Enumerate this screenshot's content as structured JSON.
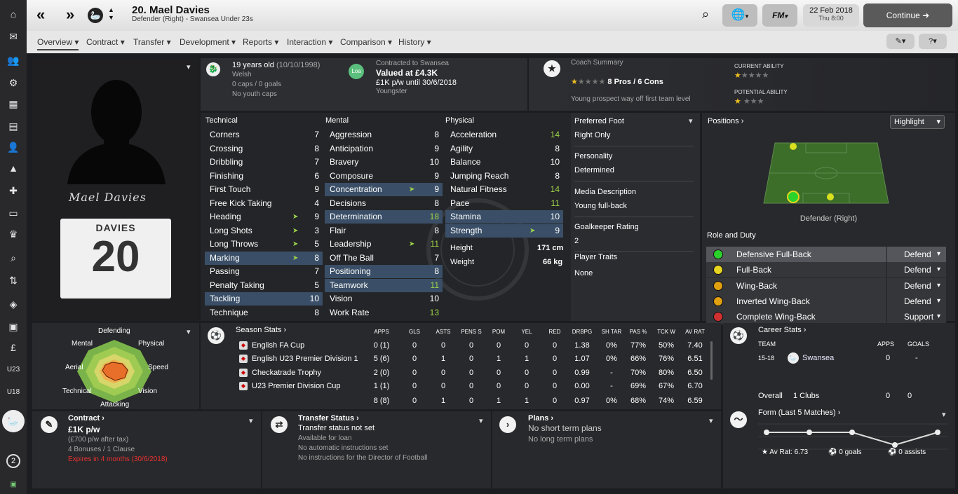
{
  "header": {
    "title": "20. Mael Davies",
    "subtitle": "Defender (Right) - Swansea Under 23s",
    "date": "22 Feb 2018",
    "day_time": "Thu 8:00",
    "continue_label": "Continue",
    "fm_label": "FM"
  },
  "nav": [
    "Overview",
    "Contract",
    "Transfer",
    "Development",
    "Reports",
    "Interaction",
    "Comparison",
    "History"
  ],
  "sidebar": {
    "badge_count": "2"
  },
  "profile": {
    "age": "19 years old",
    "dob": "(10/10/1998)",
    "nationality": "Welsh",
    "caps": "0 caps / 0 goals",
    "youth_caps": "No youth caps",
    "signature": "Mael Davies",
    "shirt_name": "DAVIES",
    "shirt_number": "20"
  },
  "contract_top": {
    "loan_badge": "Loa",
    "contracted": "Contracted to Swansea",
    "value": "Valued at £4.3K",
    "wage": "£1K p/w until 30/6/2018",
    "status": "Youngster"
  },
  "coach": {
    "title": "Coach Summary",
    "pros": "8 Pros / 6 Cons",
    "note": "Young prospect way off first team level",
    "ca_label": "CURRENT ABILITY",
    "pa_label": "POTENTIAL ABILITY",
    "ca_stars": 1,
    "pa_stars": 1
  },
  "technical": {
    "title": "Technical",
    "items": [
      {
        "name": "Corners",
        "value": "7",
        "hl": false,
        "arrow": false
      },
      {
        "name": "Crossing",
        "value": "8",
        "hl": false,
        "arrow": false
      },
      {
        "name": "Dribbling",
        "value": "7",
        "hl": false,
        "arrow": false
      },
      {
        "name": "Finishing",
        "value": "6",
        "hl": false,
        "arrow": false
      },
      {
        "name": "First Touch",
        "value": "9",
        "hl": false,
        "arrow": false
      },
      {
        "name": "Free Kick Taking",
        "value": "4",
        "hl": false,
        "arrow": false
      },
      {
        "name": "Heading",
        "value": "9",
        "hl": false,
        "arrow": true
      },
      {
        "name": "Long Shots",
        "value": "3",
        "hl": false,
        "arrow": true
      },
      {
        "name": "Long Throws",
        "value": "5",
        "hl": false,
        "arrow": true
      },
      {
        "name": "Marking",
        "value": "8",
        "hl": true,
        "arrow": true
      },
      {
        "name": "Passing",
        "value": "7",
        "hl": false,
        "arrow": false
      },
      {
        "name": "Penalty Taking",
        "value": "5",
        "hl": false,
        "arrow": false
      },
      {
        "name": "Tackling",
        "value": "10",
        "hl": true,
        "arrow": false
      },
      {
        "name": "Technique",
        "value": "8",
        "hl": false,
        "arrow": false
      }
    ]
  },
  "mental": {
    "title": "Mental",
    "items": [
      {
        "name": "Aggression",
        "value": "8",
        "hl": false,
        "arrow": false,
        "green": false
      },
      {
        "name": "Anticipation",
        "value": "9",
        "hl": false,
        "arrow": false,
        "green": false
      },
      {
        "name": "Bravery",
        "value": "10",
        "hl": false,
        "arrow": false,
        "green": false
      },
      {
        "name": "Composure",
        "value": "9",
        "hl": false,
        "arrow": false,
        "green": false
      },
      {
        "name": "Concentration",
        "value": "9",
        "hl": true,
        "arrow": true,
        "green": false
      },
      {
        "name": "Decisions",
        "value": "8",
        "hl": false,
        "arrow": false,
        "green": false
      },
      {
        "name": "Determination",
        "value": "18",
        "hl": true,
        "arrow": false,
        "green": true
      },
      {
        "name": "Flair",
        "value": "8",
        "hl": false,
        "arrow": false,
        "green": false
      },
      {
        "name": "Leadership",
        "value": "11",
        "hl": false,
        "arrow": true,
        "green": true
      },
      {
        "name": "Off The Ball",
        "value": "7",
        "hl": false,
        "arrow": false,
        "green": false
      },
      {
        "name": "Positioning",
        "value": "8",
        "hl": true,
        "arrow": false,
        "green": false
      },
      {
        "name": "Teamwork",
        "value": "11",
        "hl": true,
        "arrow": false,
        "green": true
      },
      {
        "name": "Vision",
        "value": "10",
        "hl": false,
        "arrow": false,
        "green": false
      },
      {
        "name": "Work Rate",
        "value": "13",
        "hl": false,
        "arrow": false,
        "green": true
      }
    ]
  },
  "physical": {
    "title": "Physical",
    "items": [
      {
        "name": "Acceleration",
        "value": "14",
        "hl": false,
        "arrow": false,
        "green": true
      },
      {
        "name": "Agility",
        "value": "8",
        "hl": false,
        "arrow": false,
        "green": false
      },
      {
        "name": "Balance",
        "value": "10",
        "hl": false,
        "arrow": false,
        "green": false
      },
      {
        "name": "Jumping Reach",
        "value": "8",
        "hl": false,
        "arrow": false,
        "green": false
      },
      {
        "name": "Natural Fitness",
        "value": "14",
        "hl": false,
        "arrow": false,
        "green": true
      },
      {
        "name": "Pace",
        "value": "11",
        "hl": false,
        "arrow": false,
        "green": true
      },
      {
        "name": "Stamina",
        "value": "10",
        "hl": true,
        "arrow": false,
        "green": false
      },
      {
        "name": "Strength",
        "value": "9",
        "hl": true,
        "arrow": true,
        "green": false
      }
    ],
    "height_label": "Height",
    "height": "171 cm",
    "weight_label": "Weight",
    "weight": "66 kg"
  },
  "info": {
    "foot_label": "Preferred Foot",
    "foot": "Right Only",
    "personality_label": "Personality",
    "personality": "Determined",
    "media_label": "Media Description",
    "media": "Young full-back",
    "gk_label": "Goalkeeper Rating",
    "gk": "2",
    "traits_label": "Player Traits",
    "traits": "None"
  },
  "positions": {
    "title": "Positions",
    "highlight": "Highlight",
    "position_label": "Defender (Right)",
    "role_title": "Role and Duty",
    "roles": [
      {
        "name": "Defensive Full-Back",
        "duty": "Defend",
        "color": "#2bd22b",
        "sel": true
      },
      {
        "name": "Full-Back",
        "duty": "Defend",
        "color": "#e6d420",
        "sel": false
      },
      {
        "name": "Wing-Back",
        "duty": "Defend",
        "color": "#e0a010",
        "sel": false
      },
      {
        "name": "Inverted Wing-Back",
        "duty": "Defend",
        "color": "#e0a010",
        "sel": false
      },
      {
        "name": "Complete Wing-Back",
        "duty": "Support",
        "color": "#d03030",
        "sel": false
      }
    ]
  },
  "radar": {
    "labels": [
      "Defending",
      "Physical",
      "Speed",
      "Vision",
      "Attacking",
      "Technical",
      "Aerial",
      "Mental"
    ]
  },
  "season": {
    "title": "Season Stats",
    "cols": [
      "APPS",
      "GLS",
      "ASTS",
      "PENS S",
      "POM",
      "YEL",
      "RED",
      "DRBPG",
      "SH TAR",
      "PAS %",
      "TCK W",
      "AV RAT"
    ],
    "rows": [
      {
        "comp": "English FA Cup",
        "vals": [
          "0 (1)",
          "0",
          "0",
          "0",
          "0",
          "0",
          "0",
          "1.38",
          "0%",
          "77%",
          "50%",
          "7.40"
        ]
      },
      {
        "comp": "English U23 Premier Division 1",
        "vals": [
          "5 (6)",
          "0",
          "1",
          "0",
          "1",
          "1",
          "0",
          "1.07",
          "0%",
          "66%",
          "76%",
          "6.51"
        ]
      },
      {
        "comp": "Checkatrade Trophy",
        "vals": [
          "2 (0)",
          "0",
          "0",
          "0",
          "0",
          "0",
          "0",
          "0.99",
          "-",
          "70%",
          "80%",
          "6.50"
        ]
      },
      {
        "comp": "U23 Premier Division Cup",
        "vals": [
          "1 (1)",
          "0",
          "0",
          "0",
          "0",
          "0",
          "0",
          "0.00",
          "-",
          "69%",
          "67%",
          "6.70"
        ]
      }
    ],
    "total": [
      "8 (8)",
      "0",
      "1",
      "0",
      "1",
      "1",
      "0",
      "0.97",
      "0%",
      "68%",
      "74%",
      "6.59"
    ]
  },
  "career": {
    "title": "Career Stats",
    "team_col": "TEAM",
    "apps_col": "APPS",
    "goals_col": "GOALS",
    "season": "15-18",
    "team": "Swansea",
    "apps": "0",
    "goals": "-",
    "overall": "Overall",
    "clubs": "1 Clubs",
    "o_apps": "0",
    "o_goals": "0"
  },
  "bottom": {
    "contract_title": "Contract",
    "contract_wage": "£1K p/w",
    "contract_after": "(£700 p/w after tax)",
    "contract_bonus": "4 Bonuses / 1 Clause",
    "contract_expires": "Expires in 4 months  (30/6/2018)",
    "transfer_title": "Transfer Status",
    "transfer_status": "Transfer status not set",
    "transfer_l1": "Available for loan",
    "transfer_l2": "No automatic instructions set",
    "transfer_l3": "No instructions for the Director of Football",
    "plans_title": "Plans",
    "plans_status": "No short term plans",
    "plans_l1": "No long term plans"
  },
  "form": {
    "title": "Form (Last 5 Matches)",
    "ratings": [
      6.8,
      6.8,
      6.8,
      6.5,
      6.8
    ],
    "av_rat": "Av Rat: 6.73",
    "goals": "0 goals",
    "assists": "0 assists"
  },
  "colors": {
    "accent": "#3a4f67",
    "green": "#9dd44a",
    "red": "#e83030"
  }
}
